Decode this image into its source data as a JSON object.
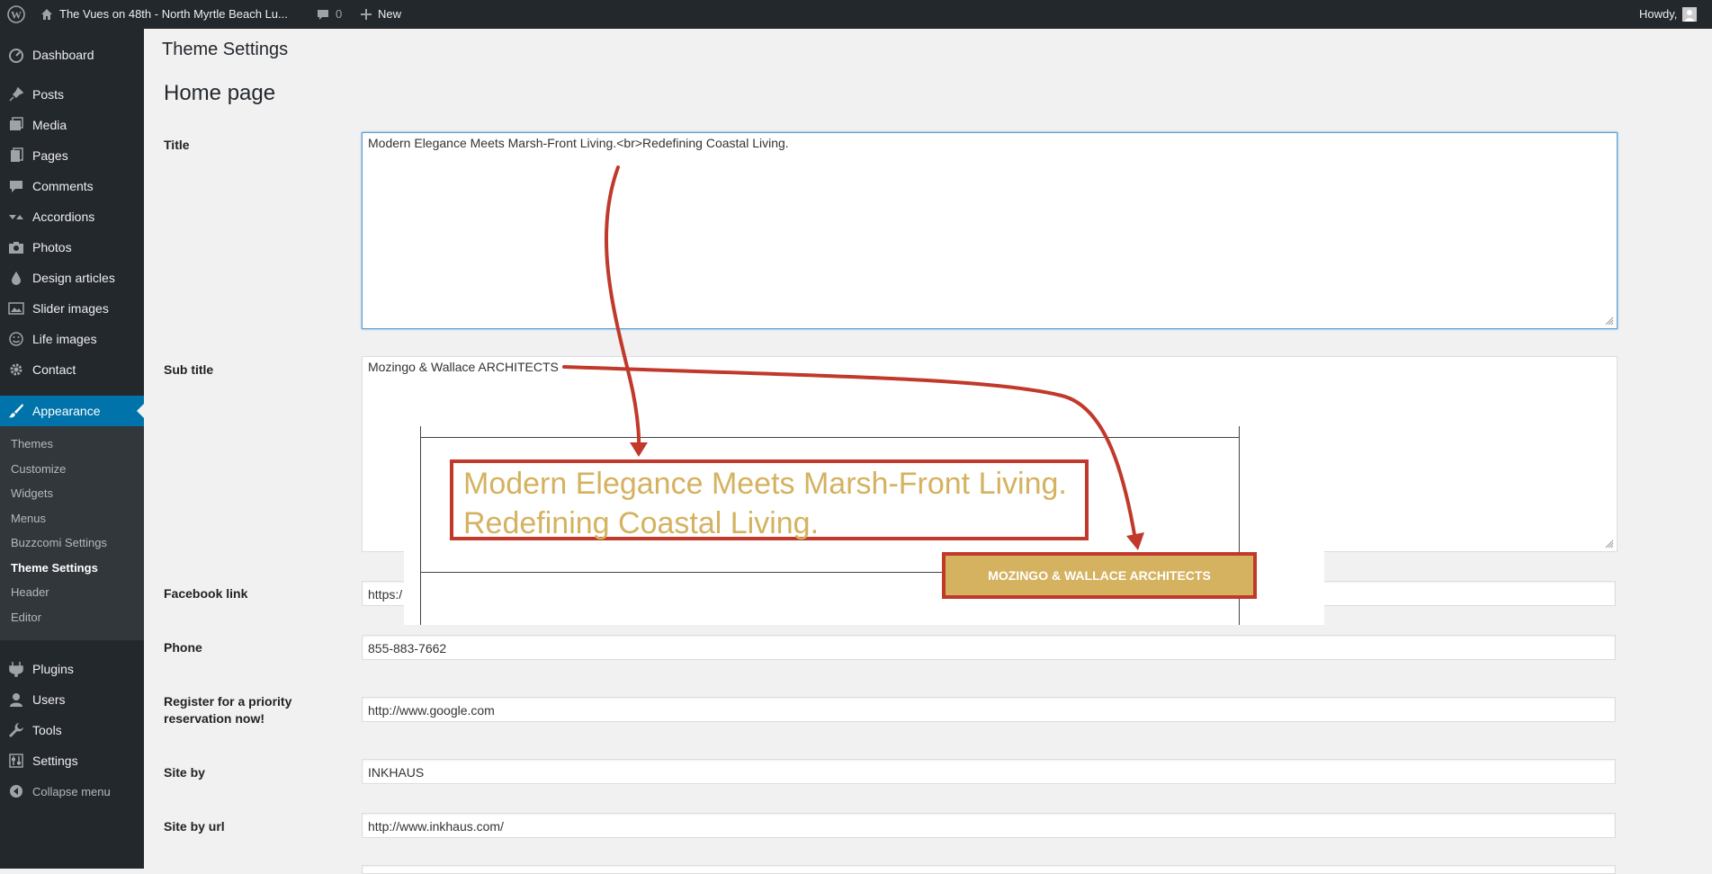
{
  "adminbar": {
    "site_name": "The Vues on 48th - North Myrtle Beach Lu...",
    "comments_count": "0",
    "new_label": "New",
    "howdy": "Howdy,"
  },
  "sidebar": {
    "items": [
      {
        "label": "Dashboard",
        "icon": "dashboard-icon"
      },
      {
        "label": "Posts",
        "icon": "pin-icon"
      },
      {
        "label": "Media",
        "icon": "media-icon"
      },
      {
        "label": "Pages",
        "icon": "pages-icon"
      },
      {
        "label": "Comments",
        "icon": "comment-icon"
      },
      {
        "label": "Accordions",
        "icon": "accordion-icon"
      },
      {
        "label": "Photos",
        "icon": "camera-icon"
      },
      {
        "label": "Design articles",
        "icon": "drop-icon"
      },
      {
        "label": "Slider images",
        "icon": "image-icon"
      },
      {
        "label": "Life images",
        "icon": "smiley-icon"
      },
      {
        "label": "Contact",
        "icon": "gear-icon"
      }
    ],
    "appearance": "Appearance",
    "submenu": [
      "Themes",
      "Customize",
      "Widgets",
      "Menus",
      "Buzzcomi Settings",
      "Theme Settings",
      "Header",
      "Editor"
    ],
    "bottom_items": [
      {
        "label": "Plugins",
        "icon": "plugin-icon"
      },
      {
        "label": "Users",
        "icon": "user-icon"
      },
      {
        "label": "Tools",
        "icon": "wrench-icon"
      },
      {
        "label": "Settings",
        "icon": "settings-icon"
      }
    ],
    "collapse": "Collapse menu"
  },
  "main": {
    "page_title": "Theme Settings",
    "section_title": "Home page",
    "fields": {
      "title": {
        "label": "Title",
        "value": "Modern Elegance Meets Marsh-Front Living.<br>Redefining Coastal Living."
      },
      "subtitle": {
        "label": "Sub title",
        "value": "Mozingo & Wallace ARCHITECTS"
      },
      "facebook": {
        "label": "Facebook link",
        "value": "https:/"
      },
      "phone": {
        "label": "Phone",
        "value": "855-883-7662"
      },
      "register": {
        "label": "Register for a priority reservation now!",
        "value": "http://www.google.com"
      },
      "siteby": {
        "label": "Site by",
        "value": "INKHAUS"
      },
      "siteby_url": {
        "label": "Site by url",
        "value": "http://www.inkhaus.com/"
      }
    }
  },
  "preview": {
    "title_line1": "Modern Elegance Meets Marsh-Front Living.",
    "title_line2": "Redefining Coastal Living.",
    "button": "MOZINGO & WALLACE ARCHITECTS"
  },
  "colors": {
    "adminbar": "#23282d",
    "accent": "#0073aa",
    "gold": "#d4b25f",
    "annotation": "#c0392b"
  }
}
